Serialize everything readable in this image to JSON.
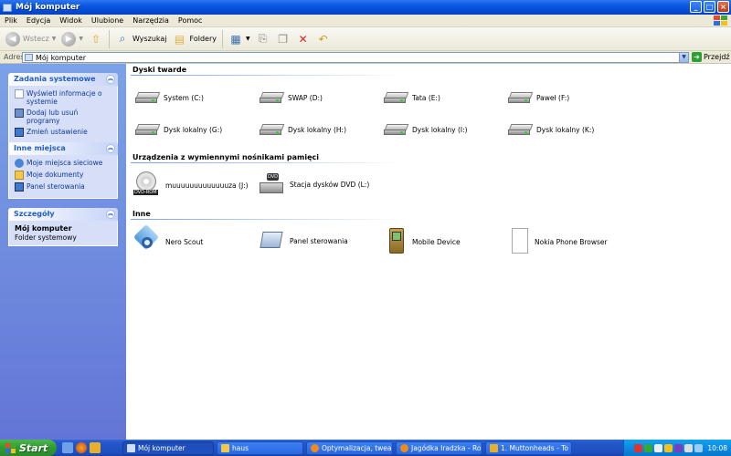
{
  "window": {
    "title": "Mój komputer"
  },
  "menu": [
    "Plik",
    "Edycja",
    "Widok",
    "Ulubione",
    "Narzędzia",
    "Pomoc"
  ],
  "toolbar": {
    "back": "Wstecz",
    "search": "Wyszukaj",
    "folders": "Foldery"
  },
  "address": {
    "label": "Adres",
    "value": "Mój komputer",
    "go": "Przejdź"
  },
  "sidebar": {
    "system_tasks": {
      "title": "Zadania systemowe",
      "items": [
        "Wyświetl informacje o systemie",
        "Dodaj lub usuń programy",
        "Zmień ustawienie"
      ]
    },
    "other_places": {
      "title": "Inne miejsca",
      "items": [
        "Moje miejsca sieciowe",
        "Moje dokumenty",
        "Panel sterowania"
      ]
    },
    "details": {
      "title": "Szczegóły",
      "name": "Mój komputer",
      "type": "Folder systemowy"
    }
  },
  "groups": {
    "hard_drives": {
      "title": "Dyski twarde",
      "items": [
        "System (C:)",
        "SWAP (D:)",
        "Tata (E:)",
        "Paweł (F:)",
        "Dysk lokalny (G:)",
        "Dysk lokalny (H:)",
        "Dysk lokalny (I:)",
        "Dysk lokalny (K:)"
      ]
    },
    "removable": {
      "title": "Urządzenia z wymiennymi nośnikami pamięci",
      "items": [
        "muuuuuuuuuuuuuza (J:)",
        "Stacja dysków DVD (L:)"
      ],
      "badge": "DVD-ROM",
      "badge2": "DVD"
    },
    "other": {
      "title": "Inne",
      "items": [
        "Nero Scout",
        "Panel sterowania",
        "Mobile Device",
        "Nokia Phone Browser"
      ]
    }
  },
  "taskbar": {
    "start": "Start",
    "tasks": [
      "Mój komputer",
      "haus",
      "Optymalizacja, tweak...",
      "Jagódka Iradzka - Ro...",
      "1. Muttonheads - To ..."
    ],
    "clock": "10:08"
  }
}
